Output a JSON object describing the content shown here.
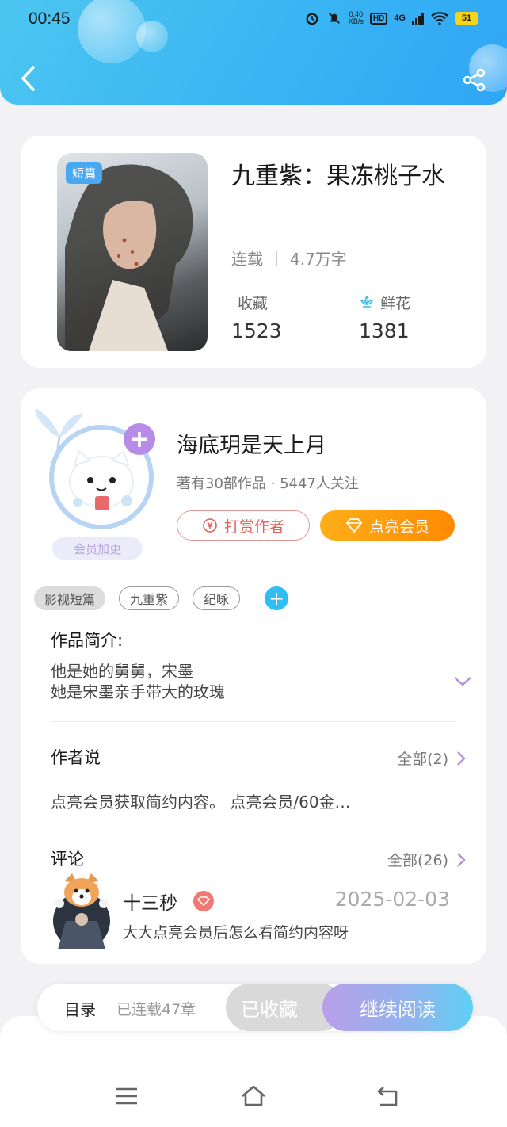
{
  "status_bar": {
    "time": "00:45",
    "speed_value": "0.40",
    "speed_unit": "KB/s",
    "hd": "HD",
    "network": "4G",
    "battery": "51"
  },
  "book": {
    "cover_tag": "短篇",
    "title": "九重紫：果冻桃子水",
    "status": "连载",
    "word_count": "4.7万字",
    "fav_label": "收藏",
    "fav_count": "1523",
    "flower_label": "鲜花",
    "flower_count": "1381"
  },
  "author": {
    "name": "海底玥是天上月",
    "meta": "著有30部作品 · 5447人关注",
    "member_tag": "会员加更",
    "tip_button": "打赏作者",
    "vip_button": "点亮会员"
  },
  "tags": [
    "影视短篇",
    "九重紫",
    "纪咏"
  ],
  "intro": {
    "title": "作品简介:",
    "line1": "他是她的舅舅，宋墨",
    "line2": "她是宋墨亲手带大的玫瑰"
  },
  "author_say": {
    "title": "作者说",
    "more": "全部(2)",
    "text": "点亮会员获取简约内容。 点亮会员/60金…"
  },
  "comments": {
    "title": "评论",
    "more": "全部(26)",
    "items": [
      {
        "user": "十三秒",
        "date": "2025-02-03",
        "text": "大大点亮会员后怎么看简约内容呀"
      }
    ]
  },
  "bottom_bar": {
    "directory": "目录",
    "chapters": "已连载47章",
    "favorited": "已收藏",
    "continue": "继续阅读"
  },
  "colors": {
    "header": "#38b3f3",
    "vip": "#ff9a0a",
    "tip": "#e0625b",
    "read_gradient_end": "#5fd0f4"
  }
}
